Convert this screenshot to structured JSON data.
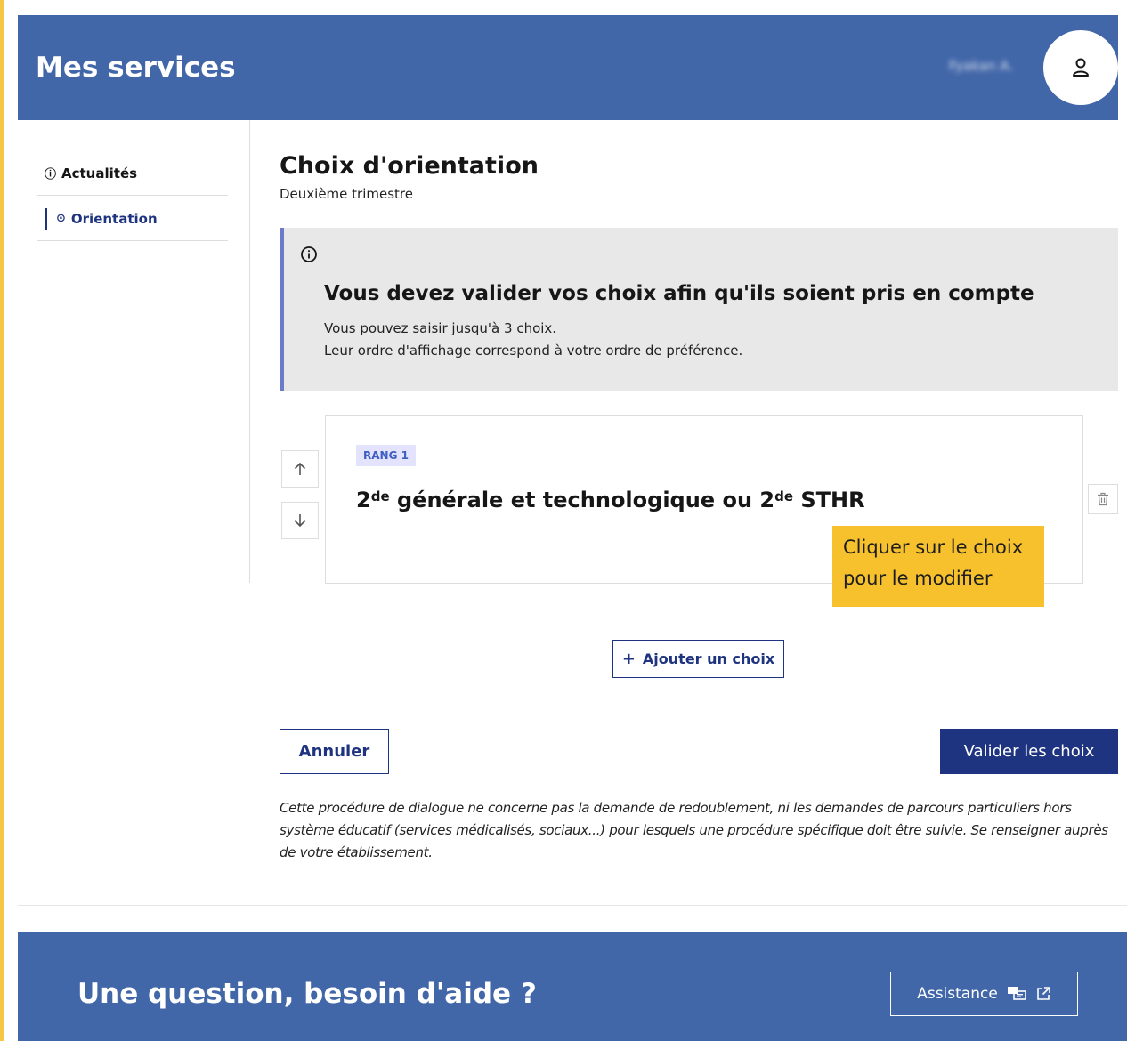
{
  "header": {
    "title": "Mes services",
    "user_name": "Fyakan A.",
    "avatar_icon": "user-icon"
  },
  "sidebar": {
    "items": [
      {
        "icon": "ⓘ",
        "label": "Actualités",
        "active": false
      },
      {
        "icon": "⊙",
        "label": "Orientation",
        "active": true
      }
    ]
  },
  "main": {
    "title": "Choix d'orientation",
    "subtitle": "Deuxième trimestre",
    "notice": {
      "icon": "info-icon",
      "title": "Vous devez valider vos choix afin qu'ils soient pris en compte",
      "line1": "Vous pouvez saisir jusqu'à 3 choix.",
      "line2": "Leur ordre d'affichage correspond à votre ordre de préférence."
    },
    "choices": [
      {
        "rank_label": "RANG 1",
        "title_part1": "2",
        "title_sup1": "de",
        "title_part2": " générale et technologique ou 2",
        "title_sup2": "de",
        "title_part3": " STHR"
      }
    ],
    "callout": {
      "line1": "Cliquer sur le choix",
      "line2": "pour le modifier"
    },
    "add_choice": {
      "plus": "+",
      "label": "Ajouter un choix"
    },
    "cancel_label": "Annuler",
    "validate_label": "Valider les choix",
    "disclaimer": "Cette procédure de dialogue ne concerne pas la demande de redoublement, ni les demandes de parcours particuliers hors système éducatif (services médicalisés, sociaux...) pour lesquels une procédure spécifique doit être suivie. Se renseigner auprès de votre établissement."
  },
  "footer": {
    "title": "Une question, besoin d'aide ?",
    "assistance_label": "Assistance"
  },
  "colors": {
    "header_blue": "#4267a9",
    "primary_navy": "#1f3480",
    "callout_yellow": "#f7c12d",
    "notice_gray": "#e8e8e8",
    "notice_border": "#6b7ac9",
    "side_rule_yellow": "#f6c744"
  }
}
